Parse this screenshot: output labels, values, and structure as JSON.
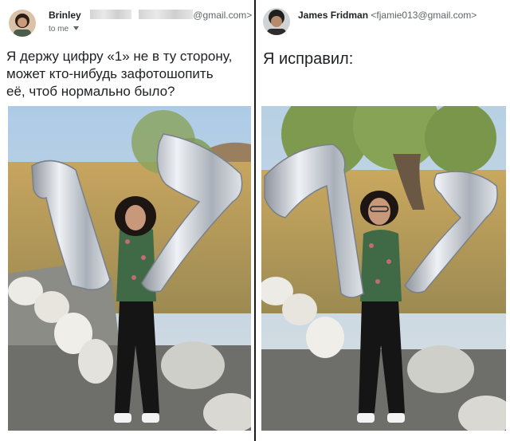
{
  "left_email": {
    "sender_name": "Brinley",
    "sender_email_suffix": "@gmail.com>",
    "recipient_label": "to me",
    "recipient_dropdown_icon": "chevron-down-icon",
    "message": "Я держу цифру «1» не в ту сторону,\nможет кто-нибудь зафотошопить\nеё, чтоб нормально было?"
  },
  "right_email": {
    "sender_name": "James Fridman",
    "sender_email": "<fjamie013@gmail.com>",
    "message": "Я исправил:"
  },
  "colors": {
    "text": "#202124",
    "secondary_text": "#5f6368",
    "divider": "#1a1a1a",
    "balloon_silver": "#c9ced6",
    "grass": "#c9ab63",
    "sky": "#b9cfe3"
  }
}
